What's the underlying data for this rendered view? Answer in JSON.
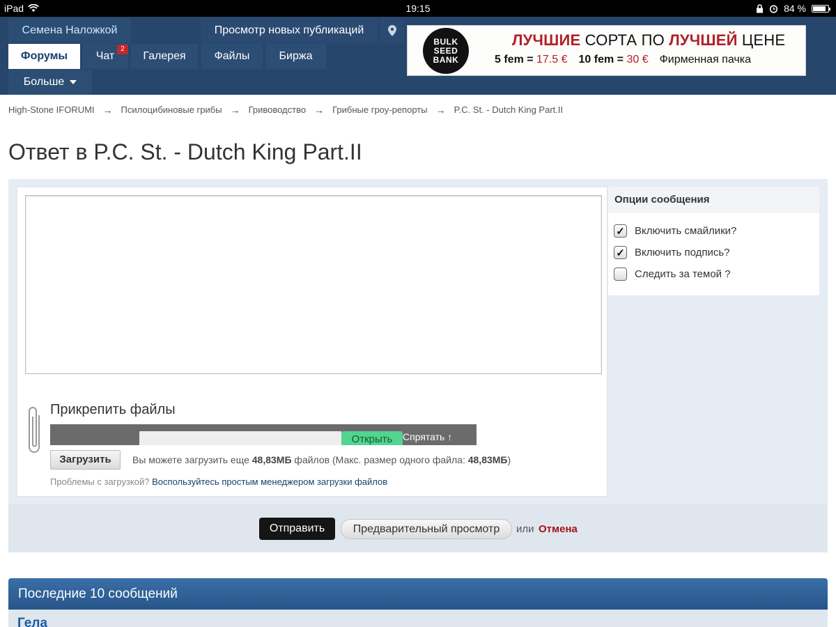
{
  "statusbar": {
    "device": "iPad",
    "time": "19:15",
    "battery": "84 %",
    "battery_level": 0.84
  },
  "nav": {
    "user": "Семена Наложкой",
    "new_posts": "Просмотр новых публикаций",
    "forums": "Форумы",
    "chat": "Чат",
    "chat_badge": "2",
    "gallery": "Галерея",
    "files": "Файлы",
    "exchange": "Биржа",
    "more": "Больше"
  },
  "banner": {
    "logo_line1": "BULK",
    "logo_line2": "SEED",
    "logo_line3": "BANK",
    "headline_1": "ЛУЧШИЕ",
    "headline_2": " СОРТА ПО ",
    "headline_3": "ЛУЧШЕЙ",
    "headline_4": " ЦЕНЕ",
    "offer1_label": "5 fem = ",
    "offer1_price": "17.5 €",
    "offer2_label": "10 fem = ",
    "offer2_price": "30 €",
    "offer3": "Фирменная пачка"
  },
  "breadcrumb": [
    "High-Stone IFORUMI",
    "Псилоцибиновые грибы",
    "Гривоводство",
    "Грибные гроу-репорты",
    "P.C. St. - Dutch King Part.II"
  ],
  "page_title": "Ответ в P.C. St. - Dutch King Part.II",
  "attach": {
    "title": "Прикрепить файлы",
    "open_button": "Открыть",
    "hide_button": "Спрятать",
    "upload_button": "Загрузить",
    "info_prefix": "Вы можете загрузить еще ",
    "info_size": "48,83МБ",
    "info_middle": " файлов (Макс. размер одного файла: ",
    "info_max": "48,83МБ",
    "info_suffix": ")",
    "problems_text": "Проблемы с загрузкой? ",
    "problems_link": "Воспользуйтесь простым менеджером загрузки файлов"
  },
  "options": {
    "title": "Опции сообщения",
    "items": [
      {
        "label": "Включить смайлики?",
        "checked": true
      },
      {
        "label": "Включить подпись?",
        "checked": true
      },
      {
        "label": "Следить за темой ?",
        "checked": false
      }
    ]
  },
  "submit": {
    "send": "Отправить",
    "preview": "Предварительный просмотр",
    "or": "или",
    "cancel": "Отмена"
  },
  "last_messages": {
    "title": "Последние 10 сообщений",
    "first_author": "Гела"
  }
}
